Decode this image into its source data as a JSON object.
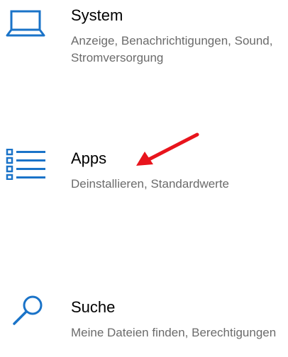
{
  "accent_color": "#1a73c8",
  "arrow_color": "#e8141c",
  "items": [
    {
      "title": "System",
      "description": "Anzeige, Benachrichtigungen, Sound, Stromversorgung",
      "icon": "laptop-icon"
    },
    {
      "title": "Apps",
      "description": "Deinstallieren, Standardwerte",
      "icon": "apps-list-icon"
    },
    {
      "title": "Suche",
      "description": "Meine Dateien finden, Berechtigungen",
      "icon": "search-icon"
    }
  ]
}
